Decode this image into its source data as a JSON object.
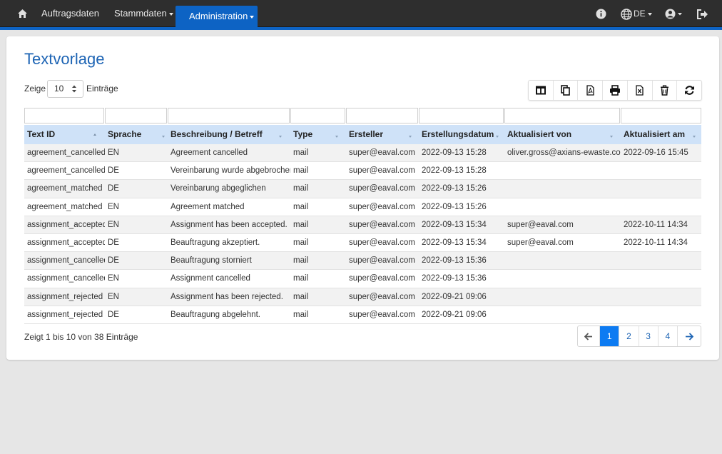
{
  "nav": {
    "items": [
      "Auftragsdaten",
      "Stammdaten",
      "Administration"
    ],
    "lang": "DE",
    "icons": [
      "home-icon",
      "info-icon",
      "globe-icon",
      "user-icon",
      "logout-icon"
    ]
  },
  "page": {
    "title": "Textvorlage",
    "length_prefix": "Zeige",
    "length_value": "10",
    "length_suffix": "Einträge",
    "info": "Zeigt 1 bis 10 von 38 Einträge"
  },
  "toolbar": [
    "columns-icon",
    "copy-icon",
    "pdf-icon",
    "print-icon",
    "excel-icon",
    "trash-icon",
    "refresh-icon"
  ],
  "table": {
    "columns": [
      "Text ID",
      "Sprache",
      "Beschreibung / Betreff",
      "Type",
      "Ersteller",
      "Erstellungsdatum",
      "Aktualisiert von",
      "Aktualisiert am"
    ],
    "rows": [
      [
        "agreement_cancelled",
        "EN",
        "Agreement cancelled",
        "mail",
        "super@eaval.com",
        "2022-09-13 15:28",
        "oliver.gross@axians-ewaste.com",
        "2022-09-16 15:45"
      ],
      [
        "agreement_cancelled",
        "DE",
        "Vereinbarung wurde abgebrochen",
        "mail",
        "super@eaval.com",
        "2022-09-13 15:28",
        "",
        ""
      ],
      [
        "agreement_matched",
        "DE",
        "Vereinbarung abgeglichen",
        "mail",
        "super@eaval.com",
        "2022-09-13 15:26",
        "",
        ""
      ],
      [
        "agreement_matched",
        "EN",
        "Agreement matched",
        "mail",
        "super@eaval.com",
        "2022-09-13 15:26",
        "",
        ""
      ],
      [
        "assignment_accepted",
        "EN",
        "Assignment has been accepted.",
        "mail",
        "super@eaval.com",
        "2022-09-13 15:34",
        "super@eaval.com",
        "2022-10-11 14:34"
      ],
      [
        "assignment_accepted",
        "DE",
        "Beauftragung akzeptiert.",
        "mail",
        "super@eaval.com",
        "2022-09-13 15:34",
        "super@eaval.com",
        "2022-10-11 14:34"
      ],
      [
        "assignment_cancelled",
        "DE",
        "Beauftragung storniert",
        "mail",
        "super@eaval.com",
        "2022-09-13 15:36",
        "",
        ""
      ],
      [
        "assignment_cancelled",
        "EN",
        "Assignment cancelled",
        "mail",
        "super@eaval.com",
        "2022-09-13 15:36",
        "",
        ""
      ],
      [
        "assignment_rejected",
        "EN",
        "Assignment has been rejected.",
        "mail",
        "super@eaval.com",
        "2022-09-21 09:06",
        "",
        ""
      ],
      [
        "assignment_rejected",
        "DE",
        "Beauftragung abgelehnt.",
        "mail",
        "super@eaval.com",
        "2022-09-21 09:06",
        "",
        ""
      ]
    ]
  },
  "pagination": {
    "prev": "←",
    "pages": [
      "1",
      "2",
      "3",
      "4"
    ],
    "next": "→"
  },
  "colors": {
    "nav_bg": "#2e2e2e",
    "accent": "#0d63c4",
    "header_bg": "#cfe2f8",
    "active_page": "#0d7bf2"
  }
}
